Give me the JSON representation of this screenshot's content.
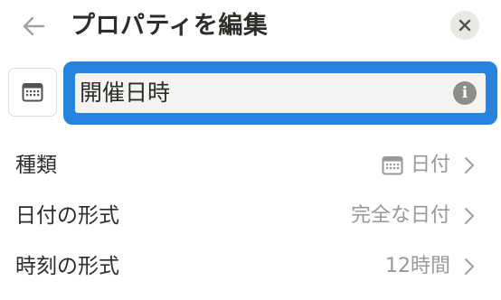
{
  "header": {
    "title": "プロパティを編集",
    "back_icon": "arrow-left-icon",
    "close_icon": "close-icon"
  },
  "property_name": {
    "icon": "calendar-icon",
    "value": "開催日時",
    "info_icon": "info-icon",
    "info_glyph": "i"
  },
  "settings": [
    {
      "label": "種類",
      "value": "日付",
      "value_icon": "calendar-icon"
    },
    {
      "label": "日付の形式",
      "value": "完全な日付"
    },
    {
      "label": "時刻の形式",
      "value": "12時間"
    }
  ],
  "colors": {
    "focus_ring": "#2783de",
    "text": "#2f2d2a",
    "muted_text": "#9b9995",
    "close_bg": "#e9e8e5"
  }
}
